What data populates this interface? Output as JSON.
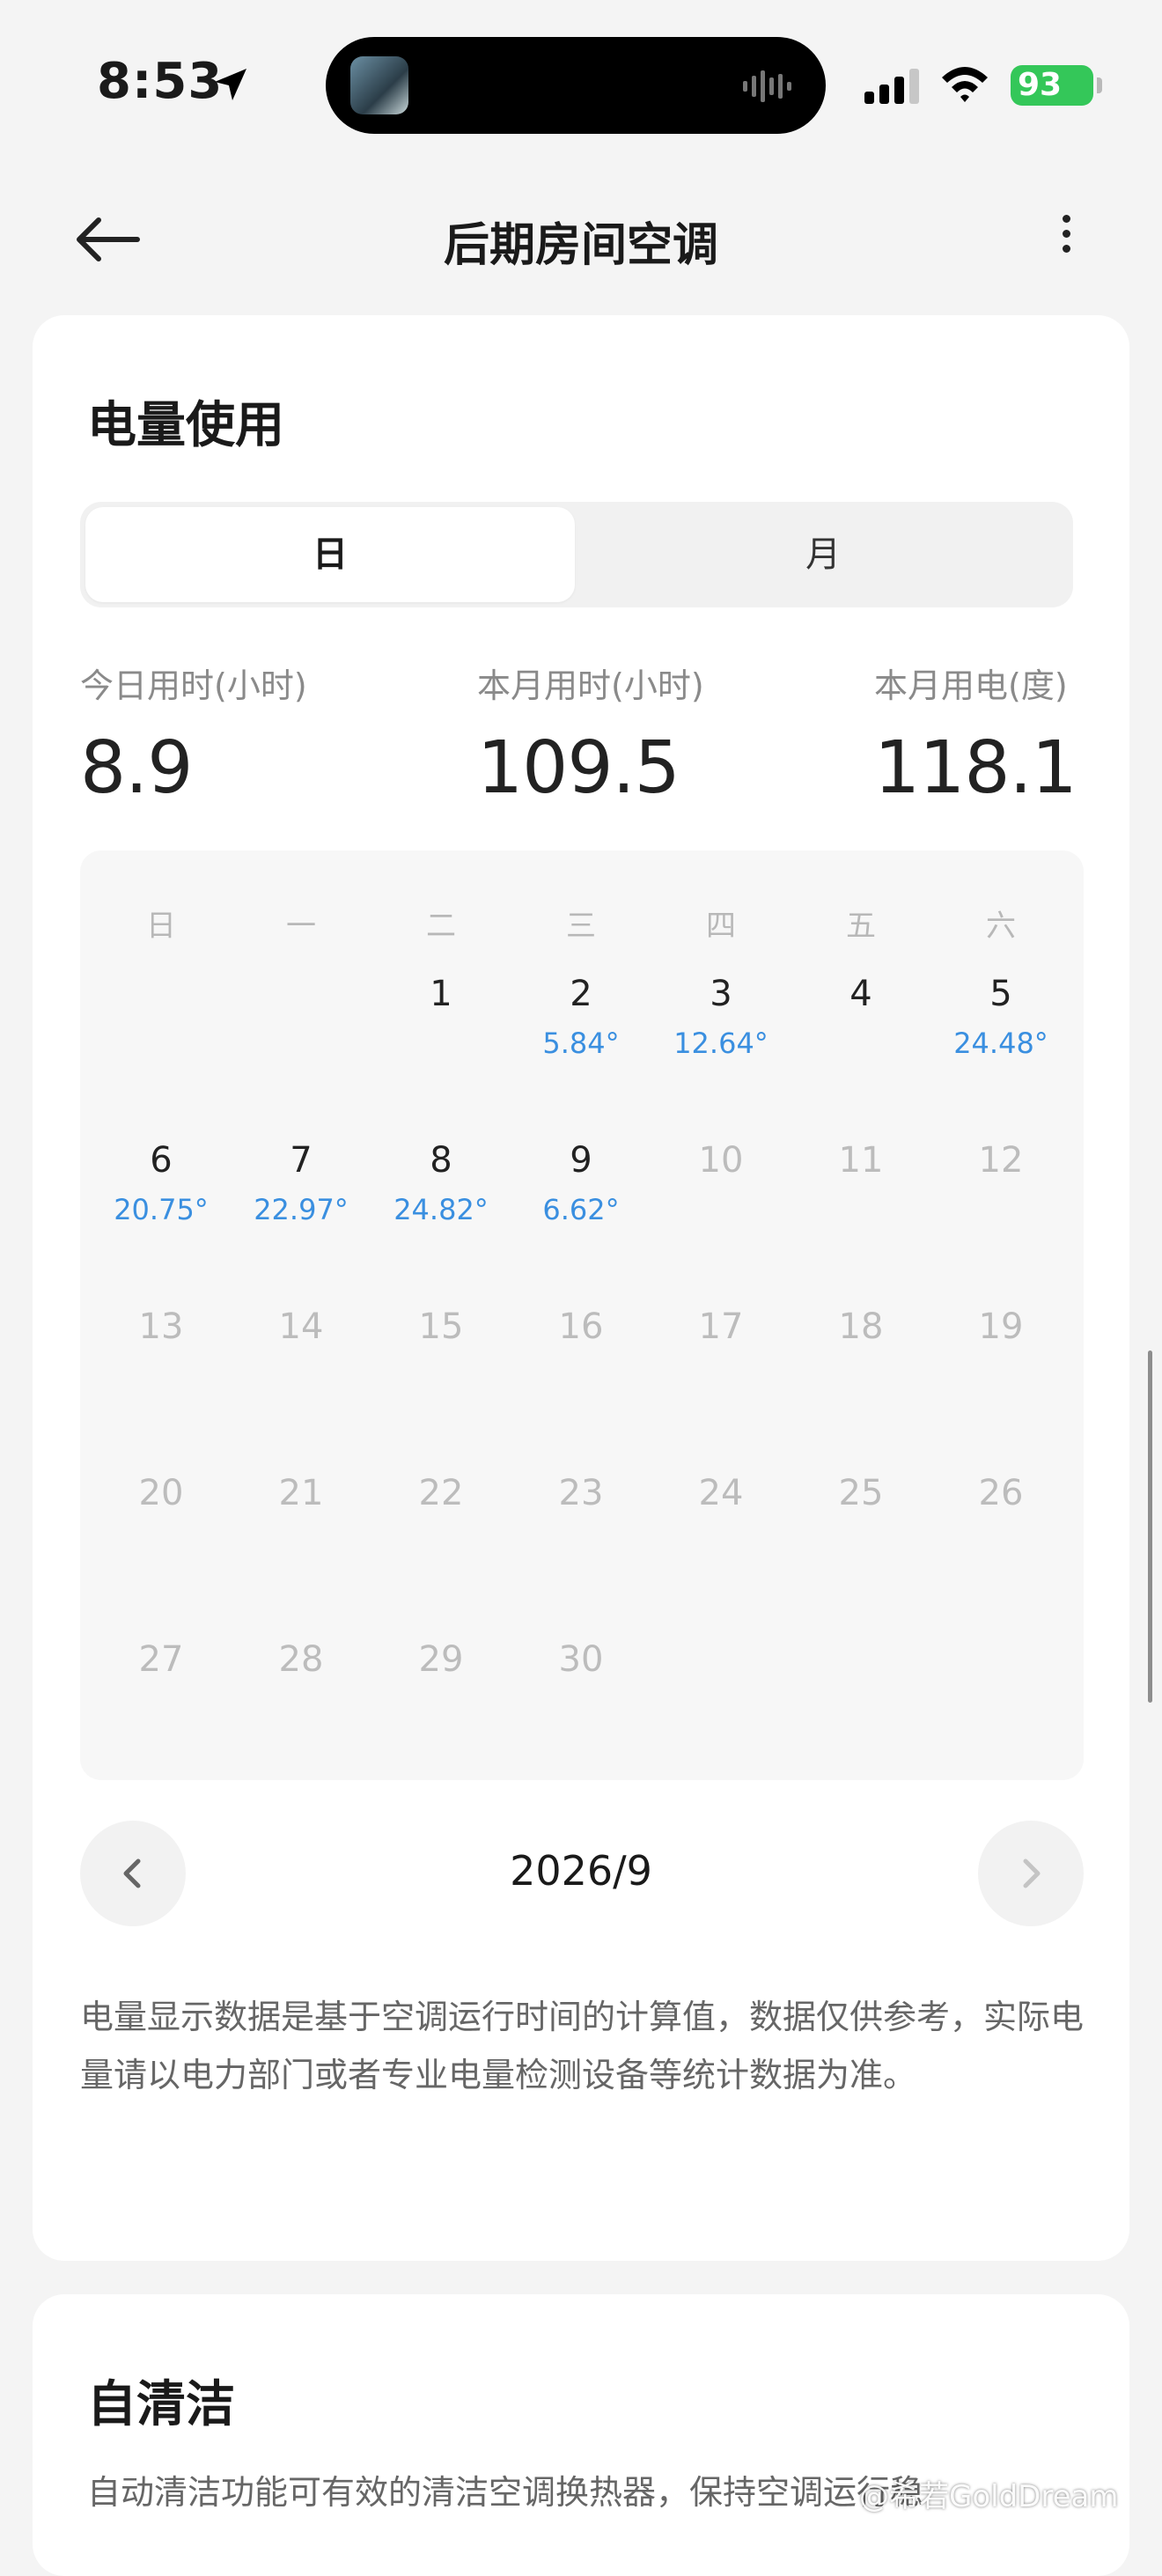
{
  "status_bar": {
    "time": "8:53",
    "battery": "93"
  },
  "header": {
    "title": "后期房间空调"
  },
  "usage": {
    "title": "电量使用",
    "tabs": [
      "日",
      "月"
    ],
    "stats": [
      {
        "label": "今日用时(小时)",
        "value": "8.9"
      },
      {
        "label": "本月用时(小时)",
        "value": "109.5"
      },
      {
        "label": "本月用电(度)",
        "value": "118.1"
      }
    ],
    "weekdays": [
      "日",
      "一",
      "二",
      "三",
      "四",
      "五",
      "六"
    ],
    "days": [
      {
        "d": "1",
        "v": ""
      },
      {
        "d": "2",
        "v": "5.84°"
      },
      {
        "d": "3",
        "v": "12.64°"
      },
      {
        "d": "4",
        "v": ""
      },
      {
        "d": "5",
        "v": "24.48°"
      },
      {
        "d": "6",
        "v": "20.75°"
      },
      {
        "d": "7",
        "v": "22.97°"
      },
      {
        "d": "8",
        "v": "24.82°"
      },
      {
        "d": "9",
        "v": "6.62°"
      },
      {
        "d": "10",
        "v": ""
      },
      {
        "d": "11",
        "v": ""
      },
      {
        "d": "12",
        "v": ""
      },
      {
        "d": "13",
        "v": ""
      },
      {
        "d": "14",
        "v": ""
      },
      {
        "d": "15",
        "v": ""
      },
      {
        "d": "16",
        "v": ""
      },
      {
        "d": "17",
        "v": ""
      },
      {
        "d": "18",
        "v": ""
      },
      {
        "d": "19",
        "v": ""
      },
      {
        "d": "20",
        "v": ""
      },
      {
        "d": "21",
        "v": ""
      },
      {
        "d": "22",
        "v": ""
      },
      {
        "d": "23",
        "v": ""
      },
      {
        "d": "24",
        "v": ""
      },
      {
        "d": "25",
        "v": ""
      },
      {
        "d": "26",
        "v": ""
      },
      {
        "d": "27",
        "v": ""
      },
      {
        "d": "28",
        "v": ""
      },
      {
        "d": "29",
        "v": ""
      },
      {
        "d": "30",
        "v": ""
      }
    ],
    "month": "2026/9",
    "note": "电量显示数据是基于空调运行时间的计算值，数据仅供参考，实际电量请以电力部门或者专业电量检测设备等统计数据为准。"
  },
  "clean": {
    "title": "自清洁",
    "desc": "自动清洁功能可有效的清洁空调换热器，保持空调运行稳"
  },
  "watermark": "@希若GoldDream",
  "colors": {
    "accent": "#3a8fe0",
    "battery": "#34c759"
  }
}
